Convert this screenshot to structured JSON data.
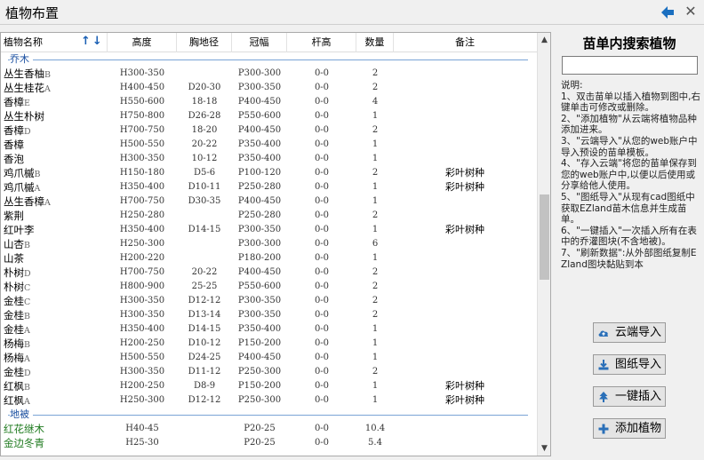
{
  "window": {
    "title": "植物布置",
    "back_icon": "arrow-left-icon",
    "close_glyph": "✕"
  },
  "table": {
    "columns": [
      "植物名称",
      "高度",
      "胸地径",
      "冠幅",
      "杆高",
      "数量",
      "备注"
    ],
    "sort_glyph": "↑↓",
    "groups": [
      {
        "label": "乔木",
        "rows": [
          {
            "name": "丛生香柚",
            "suffix": "B",
            "height": "H300-350",
            "dbh": "",
            "crown": "P300-300",
            "trunk": "0-0",
            "qty": "2",
            "note": ""
          },
          {
            "name": "丛生桂花",
            "suffix": "A",
            "height": "H400-450",
            "dbh": "D20-30",
            "crown": "P300-350",
            "trunk": "0-0",
            "qty": "2",
            "note": ""
          },
          {
            "name": "香樟",
            "suffix": "E",
            "height": "H550-600",
            "dbh": "18-18",
            "crown": "P400-450",
            "trunk": "0-0",
            "qty": "4",
            "note": ""
          },
          {
            "name": "丛生朴树",
            "suffix": "",
            "height": "H750-800",
            "dbh": "D26-28",
            "crown": "P550-600",
            "trunk": "0-0",
            "qty": "1",
            "note": ""
          },
          {
            "name": "香樟",
            "suffix": "D",
            "height": "H700-750",
            "dbh": "18-20",
            "crown": "P400-450",
            "trunk": "0-0",
            "qty": "2",
            "note": ""
          },
          {
            "name": "香樟",
            "suffix": "",
            "height": "H500-550",
            "dbh": "20-22",
            "crown": "P350-400",
            "trunk": "0-0",
            "qty": "1",
            "note": ""
          },
          {
            "name": "香泡",
            "suffix": "",
            "height": "H300-350",
            "dbh": "10-12",
            "crown": "P350-400",
            "trunk": "0-0",
            "qty": "1",
            "note": ""
          },
          {
            "name": "鸡爪槭",
            "suffix": "B",
            "height": "H150-180",
            "dbh": "D5-6",
            "crown": "P100-120",
            "trunk": "0-0",
            "qty": "2",
            "note": "彩叶树种"
          },
          {
            "name": "鸡爪槭",
            "suffix": "A",
            "height": "H350-400",
            "dbh": "D10-11",
            "crown": "P250-280",
            "trunk": "0-0",
            "qty": "1",
            "note": "彩叶树种"
          },
          {
            "name": "丛生香樟",
            "suffix": "A",
            "height": "H700-750",
            "dbh": "D30-35",
            "crown": "P400-450",
            "trunk": "0-0",
            "qty": "1",
            "note": ""
          },
          {
            "name": "紫荆",
            "suffix": "",
            "height": "H250-280",
            "dbh": "",
            "crown": "P250-280",
            "trunk": "0-0",
            "qty": "2",
            "note": ""
          },
          {
            "name": "红叶李",
            "suffix": "",
            "height": "H350-400",
            "dbh": "D14-15",
            "crown": "P300-350",
            "trunk": "0-0",
            "qty": "1",
            "note": "彩叶树种"
          },
          {
            "name": "山杏",
            "suffix": "B",
            "height": "H250-300",
            "dbh": "",
            "crown": "P300-300",
            "trunk": "0-0",
            "qty": "6",
            "note": ""
          },
          {
            "name": "山茶",
            "suffix": "",
            "height": "H200-220",
            "dbh": "",
            "crown": "P180-200",
            "trunk": "0-0",
            "qty": "1",
            "note": ""
          },
          {
            "name": "朴树",
            "suffix": "D",
            "height": "H700-750",
            "dbh": "20-22",
            "crown": "P400-450",
            "trunk": "0-0",
            "qty": "2",
            "note": ""
          },
          {
            "name": "朴树",
            "suffix": "C",
            "height": "H800-900",
            "dbh": "25-25",
            "crown": "P550-600",
            "trunk": "0-0",
            "qty": "2",
            "note": ""
          },
          {
            "name": "金桂",
            "suffix": "C",
            "height": "H300-350",
            "dbh": "D12-12",
            "crown": "P300-350",
            "trunk": "0-0",
            "qty": "2",
            "note": ""
          },
          {
            "name": "金桂",
            "suffix": "B",
            "height": "H300-350",
            "dbh": "D13-14",
            "crown": "P300-350",
            "trunk": "0-0",
            "qty": "2",
            "note": ""
          },
          {
            "name": "金桂",
            "suffix": "A",
            "height": "H350-400",
            "dbh": "D14-15",
            "crown": "P350-400",
            "trunk": "0-0",
            "qty": "1",
            "note": ""
          },
          {
            "name": "杨梅",
            "suffix": "B",
            "height": "H200-250",
            "dbh": "D10-12",
            "crown": "P150-200",
            "trunk": "0-0",
            "qty": "1",
            "note": ""
          },
          {
            "name": "杨梅",
            "suffix": "A",
            "height": "H500-550",
            "dbh": "D24-25",
            "crown": "P400-450",
            "trunk": "0-0",
            "qty": "1",
            "note": ""
          },
          {
            "name": "金桂",
            "suffix": "D",
            "height": "H300-350",
            "dbh": "D11-12",
            "crown": "P250-300",
            "trunk": "0-0",
            "qty": "2",
            "note": ""
          },
          {
            "name": "红枫",
            "suffix": "B",
            "height": "H200-250",
            "dbh": "D8-9",
            "crown": "P150-200",
            "trunk": "0-0",
            "qty": "1",
            "note": "彩叶树种"
          },
          {
            "name": "红枫",
            "suffix": "A",
            "height": "H250-300",
            "dbh": "D12-12",
            "crown": "P250-300",
            "trunk": "0-0",
            "qty": "1",
            "note": "彩叶树种"
          }
        ]
      },
      {
        "label": "地被",
        "rows": [
          {
            "name": "红花继木",
            "suffix": "",
            "height": "H40-45",
            "dbh": "",
            "crown": "P20-25",
            "trunk": "0-0",
            "qty": "10.4",
            "note": ""
          },
          {
            "name": "金边冬青",
            "suffix": "",
            "height": "H25-30",
            "dbh": "",
            "crown": "P20-25",
            "trunk": "0-0",
            "qty": "5.4",
            "note": ""
          }
        ]
      }
    ]
  },
  "side": {
    "title": "苗单内搜索植物",
    "search_value": "",
    "instructions": [
      "说明:",
      "1、双击苗单以插入植物到图中,右键单击可修改或删除。",
      "2、\"添加植物\"从云端将植物品种添加进来。",
      "3、\"云端导入\"从您的web账户中导入预设的苗单模板。",
      "4、\"存入云端\"将您的苗单保存到您的web账户中,以便以后使用或分享给他人使用。",
      "5、\"图纸导入\"从现有cad图纸中获取EZland苗木信息并生成苗单。",
      "6、\"一键插入\"一次插入所有在表中的乔灌图块(不含地被)。",
      "7、\"刷新数据\":从外部图纸复制EZland图块黏贴到本"
    ],
    "buttons": [
      {
        "label": "云端导入",
        "icon": "cloud-upload-icon"
      },
      {
        "label": "图纸导入",
        "icon": "download-icon"
      },
      {
        "label": "一键插入",
        "icon": "tree-insert-icon"
      },
      {
        "label": "添加植物",
        "icon": "plus-icon"
      }
    ]
  },
  "colors": {
    "accent": "#1a5fb4",
    "group_text": "#1a4fa0",
    "groundcover_text": "#1e7a1e"
  }
}
